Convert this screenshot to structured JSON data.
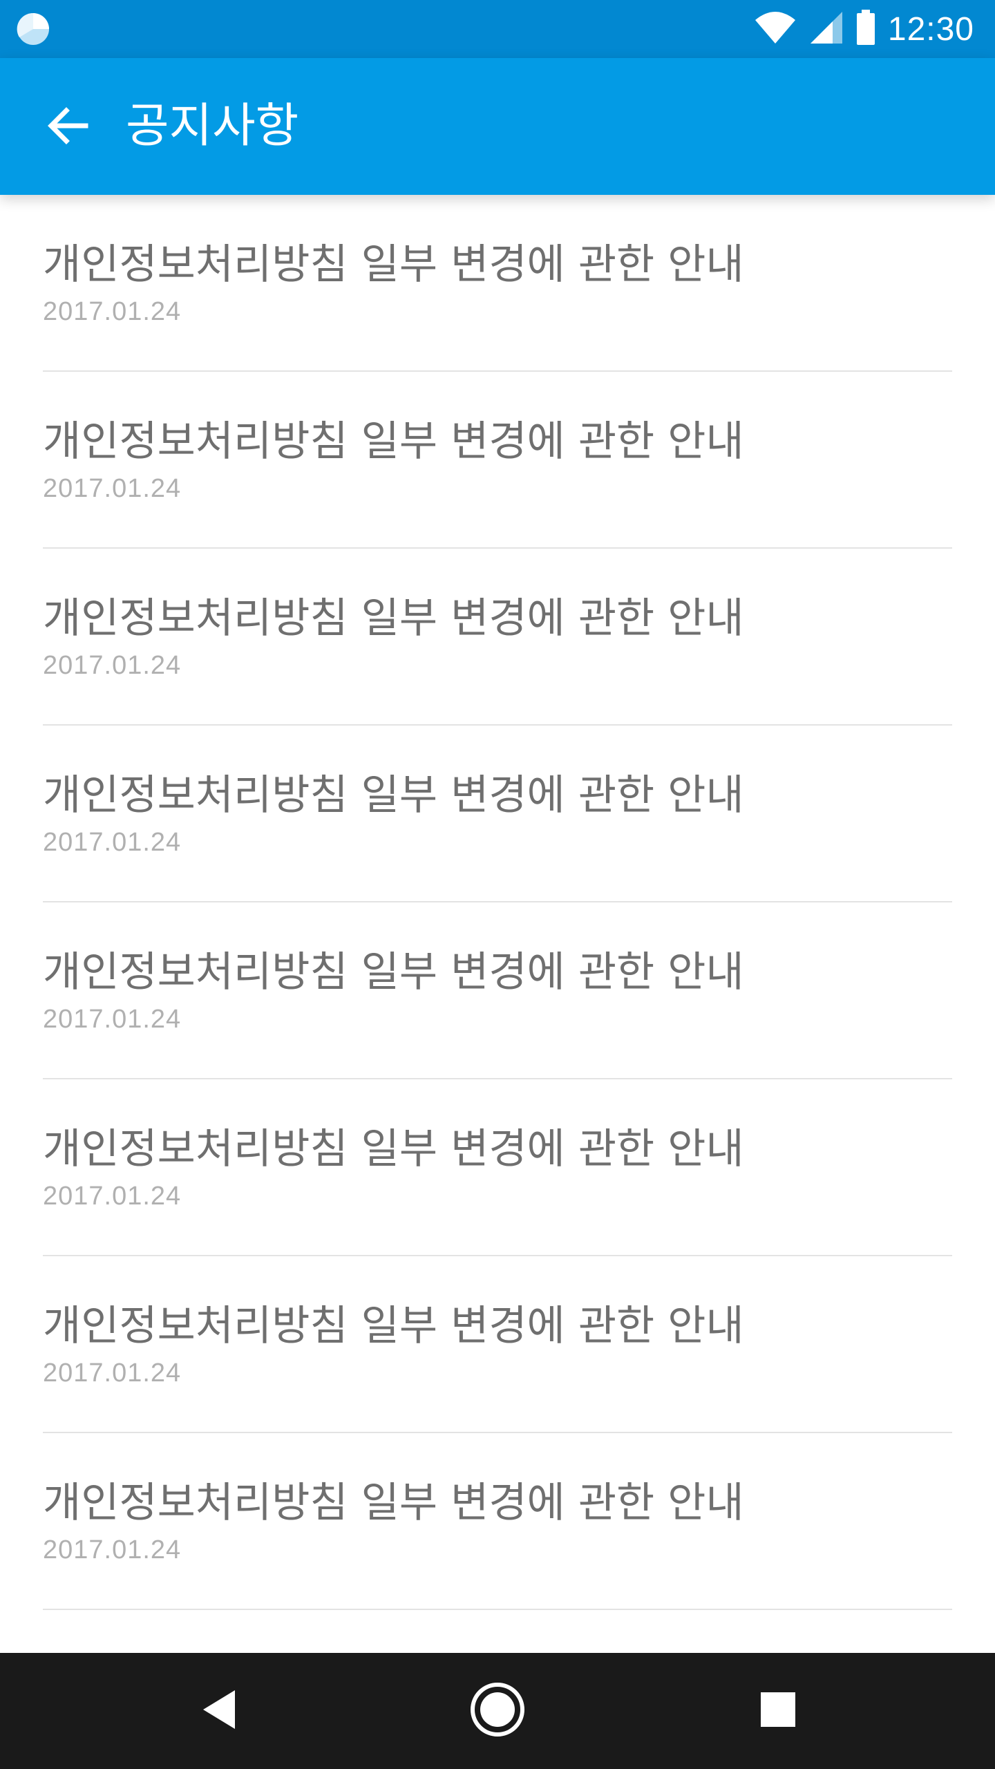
{
  "status_bar": {
    "time": "12:30",
    "app_icon": "pie-chart-icon",
    "icons": [
      "wifi-icon",
      "signal-icon",
      "battery-icon"
    ],
    "background": "#0288d1"
  },
  "app_bar": {
    "title": "공지사항",
    "back_icon": "arrow-left-icon",
    "background": "#039be5"
  },
  "notices": [
    {
      "title": "개인정보처리방침 일부 변경에 관한 안내",
      "date": "2017.01.24"
    },
    {
      "title": "개인정보처리방침 일부 변경에 관한 안내",
      "date": "2017.01.24"
    },
    {
      "title": "개인정보처리방침 일부 변경에 관한 안내",
      "date": "2017.01.24"
    },
    {
      "title": "개인정보처리방침 일부 변경에 관한 안내",
      "date": "2017.01.24"
    },
    {
      "title": "개인정보처리방침 일부 변경에 관한 안내",
      "date": "2017.01.24"
    },
    {
      "title": "개인정보처리방침 일부 변경에 관한 안내",
      "date": "2017.01.24"
    },
    {
      "title": "개인정보처리방침 일부 변경에 관한 안내",
      "date": "2017.01.24"
    },
    {
      "title": "개인정보처리방침 일부 변경에 관한 안내",
      "date": "2017.01.24"
    }
  ],
  "nav_bar": {
    "buttons": [
      "back-triangle-icon",
      "home-circle-icon",
      "recent-square-icon"
    ],
    "background": "#1a1a1a"
  }
}
